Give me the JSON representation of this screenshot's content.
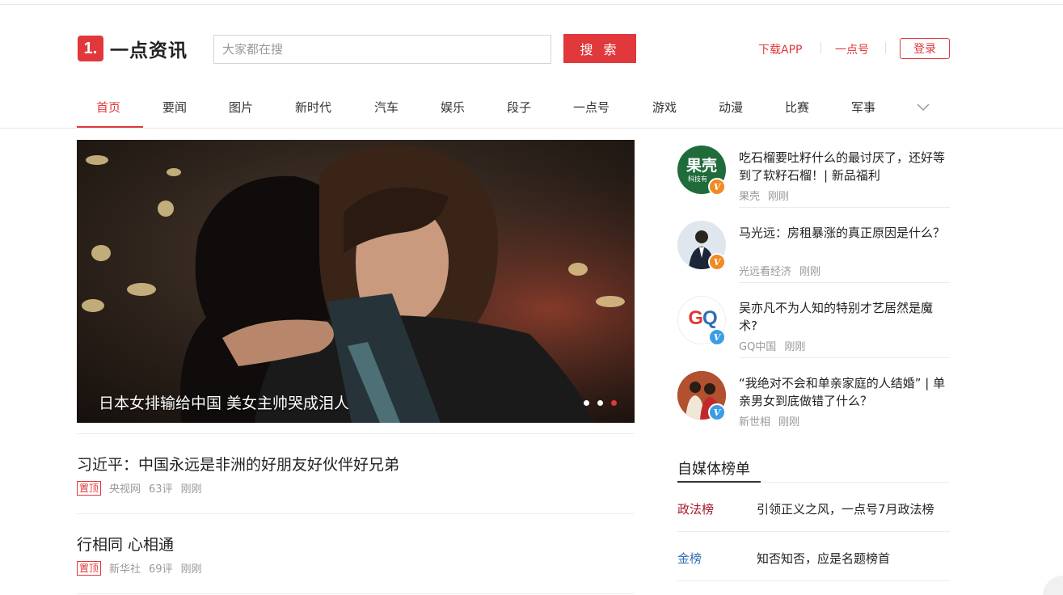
{
  "header": {
    "logo_mark": "1.",
    "logo_text": "一点资讯",
    "search_placeholder": "大家都在搜",
    "search_button": "搜 索",
    "download_app": "下载APP",
    "yidian_hao": "一点号",
    "login": "登录"
  },
  "nav": {
    "items": [
      "首页",
      "要闻",
      "图片",
      "新时代",
      "汽车",
      "娱乐",
      "段子",
      "一点号",
      "游戏",
      "动漫",
      "比赛",
      "军事"
    ],
    "active_index": 0
  },
  "carousel": {
    "caption": "日本女排输给中国 美女主帅哭成泪人",
    "slide_count": 3,
    "active_slide": 3
  },
  "feed": [
    {
      "title": "习近平：中国永远是非洲的好朋友好伙伴好兄弟",
      "tag": "置顶",
      "source": "央视网",
      "comments": "63评",
      "time": "刚刚"
    },
    {
      "title": "行相同 心相通",
      "tag": "置顶",
      "source": "新华社",
      "comments": "69评",
      "time": "刚刚"
    }
  ],
  "side_articles": [
    {
      "title": "吃石榴要吐籽什么的最讨厌了，还好等到了软籽石榴！| 新品福利",
      "source": "果壳",
      "time": "刚刚",
      "avatar_icon": "guokr-logo",
      "avatar_text": "果壳",
      "avatar_subtext": "科技有",
      "badge": "V",
      "badge_color": "#f08a24"
    },
    {
      "title": "马光远：房租暴涨的真正原因是什么？",
      "source": "光远看经济",
      "time": "刚刚",
      "avatar_icon": "person-photo",
      "badge": "V",
      "badge_color": "#f08a24"
    },
    {
      "title": "吴亦凡不为人知的特别才艺居然是魔术?",
      "source": "GQ中国",
      "time": "刚刚",
      "avatar_icon": "gq-logo",
      "avatar_text": "GQ",
      "badge": "V",
      "badge_color": "#3a9ee4"
    },
    {
      "title": "“我绝对不会和单亲家庭的人结婚” | 单亲男女到底做错了什么？",
      "source": "新世相",
      "time": "刚刚",
      "avatar_icon": "couple-photo",
      "badge": "V",
      "badge_color": "#3a9ee4"
    }
  ],
  "rankings": {
    "heading": "自媒体榜单",
    "items": [
      {
        "category": "政法榜",
        "text": "引领正义之风，一点号7月政法榜",
        "color": "#a3172a"
      },
      {
        "category": "金榜",
        "text": "知否知否，应是名题榜首",
        "color": "#2f6fb5"
      }
    ]
  },
  "colors": {
    "accent": "#e0383b"
  }
}
